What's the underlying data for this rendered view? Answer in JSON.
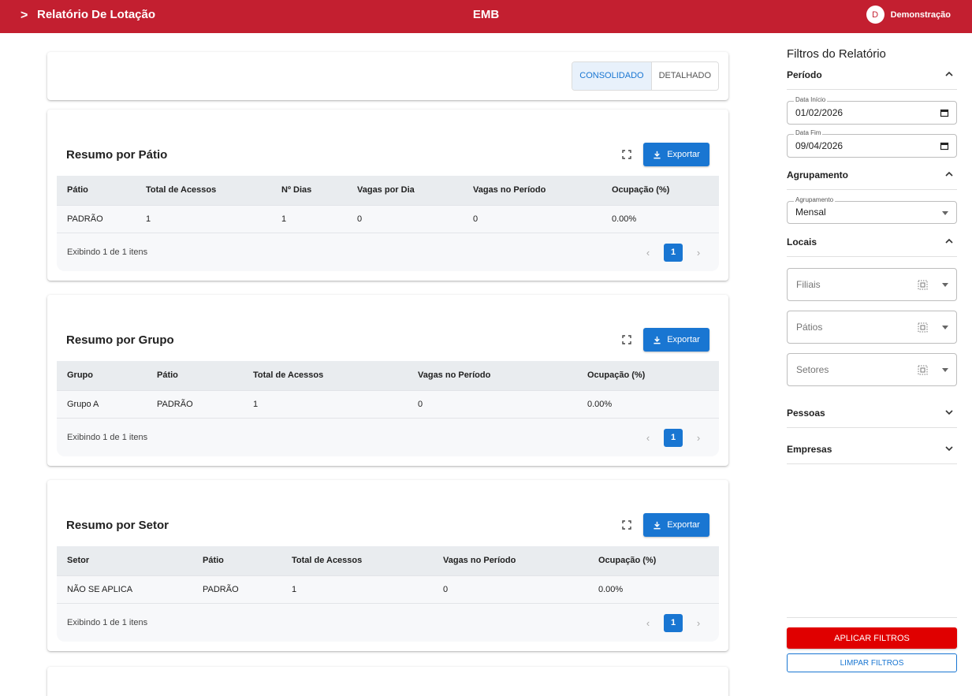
{
  "header": {
    "title": "Relatório De Lotação",
    "brand": "EMB",
    "user_initial": "D",
    "user_name": "Demonstração"
  },
  "view_toggle": {
    "consolidated_label": "CONSOLIDADO",
    "detailed_label": "DETALHADO",
    "active": "CONSOLIDADO"
  },
  "export_label": "Exportar",
  "sections": {
    "patio": {
      "title": "Resumo por Pátio",
      "columns": [
        "Pátio",
        "Total de Acessos",
        "Nº Dias",
        "Vagas por Dia",
        "Vagas no Período",
        "Ocupação (%)"
      ],
      "rows": [
        [
          "PADRÃO",
          "1",
          "1",
          "0",
          "0",
          "0.00%"
        ]
      ],
      "footer": "Exibindo 1 de 1 itens",
      "page": "1"
    },
    "grupo": {
      "title": "Resumo por Grupo",
      "columns": [
        "Grupo",
        "Pátio",
        "Total de Acessos",
        "Vagas no Período",
        "Ocupação (%)"
      ],
      "rows": [
        [
          "Grupo A",
          "PADRÃO",
          "1",
          "0",
          "0.00%"
        ]
      ],
      "footer": "Exibindo 1 de 1 itens",
      "page": "1"
    },
    "setor": {
      "title": "Resumo por Setor",
      "columns": [
        "Setor",
        "Pátio",
        "Total de Acessos",
        "Vagas no Período",
        "Ocupação (%)"
      ],
      "rows": [
        [
          "NÃO SE APLICA",
          "PADRÃO",
          "1",
          "0",
          "0.00%"
        ]
      ],
      "footer": "Exibindo 1 de 1 itens",
      "page": "1"
    }
  },
  "sidebar": {
    "title": "Filtros do Relatório",
    "periodo": {
      "label": "Período",
      "start_label": "Data Início",
      "start_value": "01/02/2026",
      "end_label": "Data Fim",
      "end_value": "09/04/2026"
    },
    "agrupamento": {
      "label": "Agrupamento",
      "field_label": "Agrupamento",
      "value": "Mensal"
    },
    "locais": {
      "label": "Locais",
      "filiais": "Filiais",
      "patios": "Pátios",
      "setores": "Setores"
    },
    "pessoas_label": "Pessoas",
    "empresas_label": "Empresas",
    "apply_label": "APLICAR FILTROS",
    "clear_label": "LIMPAR FILTROS"
  },
  "colors": {
    "header_bg": "#c31f30",
    "primary": "#1976d2",
    "apply_bg": "#e00000"
  }
}
